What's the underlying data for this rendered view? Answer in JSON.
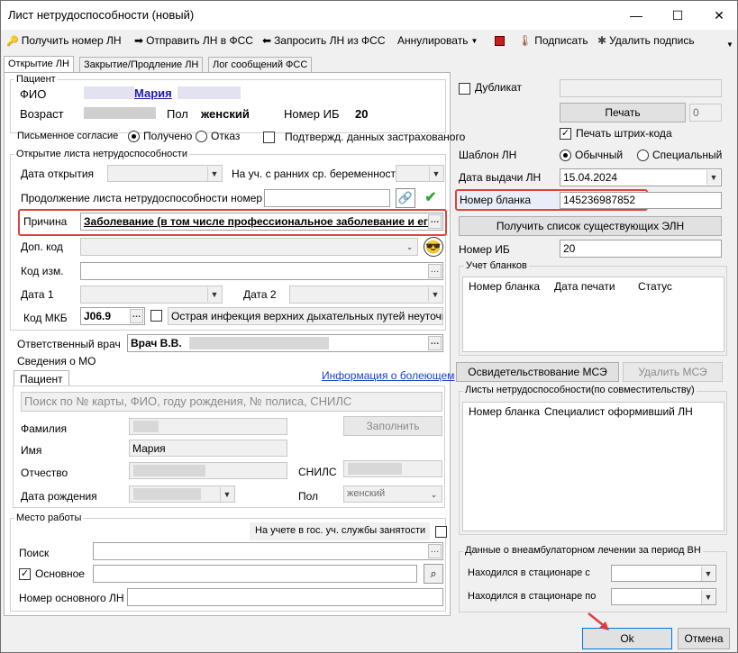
{
  "window": {
    "title": "Лист нетрудоспособности (новый)",
    "min": "—",
    "max": "☐",
    "close": "✕"
  },
  "toolbar": {
    "get_ln": "Получить номер ЛН",
    "send_ln": "Отправить ЛН в ФСС",
    "request_ln": "Запросить ЛН из ФСС",
    "annul": "Аннулировать",
    "sign": "Подписать",
    "remove_sign": "Удалить подпись"
  },
  "tabs": [
    "Открытие ЛН",
    "Закрытие/Продление ЛН",
    "Лог сообщений ФСС"
  ],
  "patient": {
    "legend": "Пациент",
    "fio_label": "ФИО",
    "fio_value": "Мария",
    "age_label": "Возраст",
    "sex_label": "Пол",
    "sex_value": "женский",
    "ib_label": "Номер ИБ",
    "ib_value": "20"
  },
  "consent": {
    "label": "Письменное согласие",
    "received": "Получено",
    "refusal": "Отказ",
    "confirm_label": "Подтвержд. данных застрахованого"
  },
  "opening": {
    "legend": "Открытие листа нетрудоспособности",
    "date_label": "Дата открытия",
    "pregnancy_label": "На уч. с ранних ср. беременности",
    "continuation_label": "Продолжение листа нетрудоспособности номер",
    "reason_label": "Причина",
    "reason_value": "Заболевание (в том числе профессиональное заболевание и его",
    "dop_label": "Доп. код",
    "kod_izm_label": "Код изм.",
    "date1_label": "Дата 1",
    "date2_label": "Дата 2",
    "mkb_label": "Код МКБ",
    "mkb_code": "J06.9",
    "mkb_text": "Острая инфекция верхних дыхательных путей неуточненна"
  },
  "doctor": {
    "label": "Ответственный врач",
    "value": "Врач В.В."
  },
  "mo": {
    "label": "Сведения о МО",
    "tab": "Пациент",
    "info_link": "Информация о болеющем",
    "search_placeholder": "Поиск по № карты, ФИО, году рождения, № полиса, СНИЛС",
    "last_name": "Фамилия",
    "first_name": "Имя",
    "first_name_value": "Мария",
    "patronymic": "Отчество",
    "snils": "СНИЛС",
    "birth_date": "Дата рождения",
    "sex": "Пол",
    "sex_value": "женский",
    "fill_button": "Заполнить"
  },
  "work": {
    "legend": "Место работы",
    "employment_label": "На учете в гос. уч. службы занятости",
    "search_label": "Поиск",
    "main_label": "Основное",
    "main_ln_label": "Номер основного ЛН"
  },
  "right": {
    "duplicate": "Дубликат",
    "print": "Печать",
    "print_count": "0",
    "barcode": "Печать штрих-кода",
    "template_label": "Шаблон ЛН",
    "template_normal": "Обычный",
    "template_special": "Специальный",
    "issue_date_label": "Дата выдачи ЛН",
    "issue_date": "15.04.2024",
    "blank_label": "Номер бланка",
    "blank_value": "145236987852",
    "get_list_button": "Получить список существующих ЭЛН",
    "ib_label": "Номер ИБ",
    "ib_value": "20",
    "blanks_legend": "Учет бланков",
    "blanks_cols": [
      "Номер бланка",
      "Дата печати",
      "Статус"
    ],
    "mse_button": "Освидетельствование МСЭ",
    "del_mse_button": "Удалить МСЭ",
    "combined_legend": "Листы нетрудоспособности(по совместительству)",
    "combined_cols": [
      "Номер бланка",
      "Специалист оформивший ЛН"
    ],
    "hospital_legend": "Данные о внеамбулаторном лечении за период ВН",
    "hosp_from": "Находился в стационаре с",
    "hosp_to": "Находился в стационаре по"
  },
  "footer": {
    "ok": "Ok",
    "cancel": "Отмена"
  }
}
